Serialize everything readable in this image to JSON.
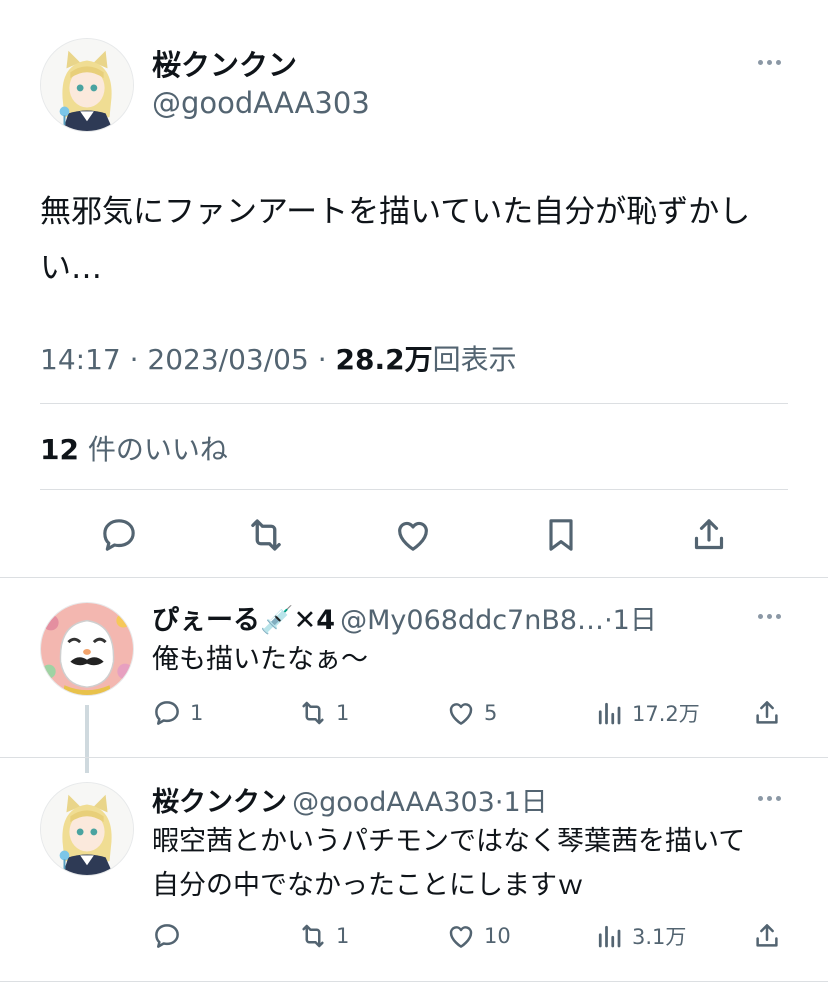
{
  "main_tweet": {
    "author_name": "桜クンクン",
    "author_handle": "@goodAAA303",
    "text": "無邪気にファンアートを描いていた自分が恥ずかしい…",
    "time": "14:17",
    "date": "2023/03/05",
    "views_count": "28.2万",
    "views_label": "回表示",
    "likes_count": "12",
    "likes_label": "件のいいね"
  },
  "replies": [
    {
      "author_name": "ぴぇーる💉✕4",
      "author_handle": "@My068ddc7nB8…",
      "time_ago": "1日",
      "text": "俺も描いたなぁ〜",
      "reply_count": "1",
      "retweet_count": "1",
      "like_count": "5",
      "view_count": "17.2万"
    },
    {
      "author_name": "桜クンクン",
      "author_handle": "@goodAAA303",
      "time_ago": "1日",
      "text": "暇空茜とかいうパチモンではなく琴葉茜を描いて自分の中でなかったことにしますｗ",
      "reply_count": "",
      "retweet_count": "1",
      "like_count": "10",
      "view_count": "3.1万"
    }
  ],
  "colors": {
    "text": "#0f1419",
    "muted": "#536471",
    "divider": "#dcdfe2",
    "thread_line": "#cfd9de"
  }
}
